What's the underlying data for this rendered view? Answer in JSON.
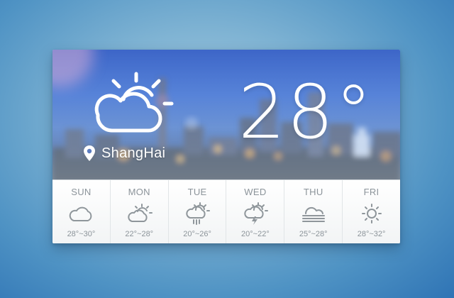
{
  "current": {
    "temperature": "28°",
    "city": "ShangHai",
    "icon": "partly-cloudy-icon",
    "location_icon": "location-pin-icon"
  },
  "forecast": [
    {
      "day": "SUN",
      "icon": "cloud-icon",
      "range": "28°~30°"
    },
    {
      "day": "MON",
      "icon": "partly-cloudy-icon",
      "range": "22°~28°"
    },
    {
      "day": "TUE",
      "icon": "sun-rain-icon",
      "range": "20°~26°"
    },
    {
      "day": "WED",
      "icon": "thunderstorm-icon",
      "range": "20°~22°"
    },
    {
      "day": "THU",
      "icon": "fog-icon",
      "range": "25°~28°"
    },
    {
      "day": "FRI",
      "icon": "sun-icon",
      "range": "28°~32°"
    }
  ],
  "colors": {
    "sky_top": "#3d66c8",
    "forecast_text": "#8c949a",
    "icon_stroke": "#8f969b",
    "temperature_text": "#ffffff"
  }
}
